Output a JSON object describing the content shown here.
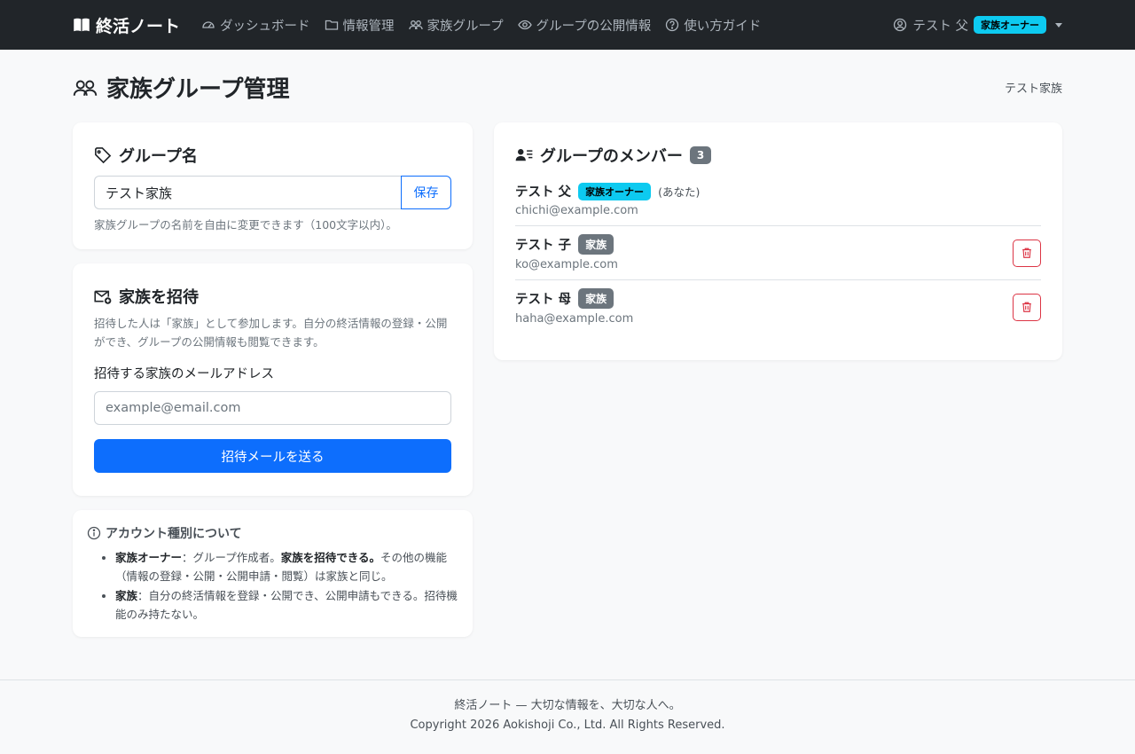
{
  "navbar": {
    "brand": "終活ノート",
    "items": [
      {
        "label": "ダッシュボード",
        "icon": "speedometer-icon"
      },
      {
        "label": "情報管理",
        "icon": "folder-icon"
      },
      {
        "label": "家族グループ",
        "icon": "people-icon"
      },
      {
        "label": "グループの公開情報",
        "icon": "eye-icon"
      },
      {
        "label": "使い方ガイド",
        "icon": "question-circle-icon"
      }
    ],
    "user_name": "テスト 父",
    "user_role": "家族オーナー"
  },
  "page": {
    "title": "家族グループ管理",
    "group_name": "テスト家族"
  },
  "group_card": {
    "title": "グループ名",
    "input_value": "テスト家族",
    "save_label": "保存",
    "help": "家族グループの名前を自由に変更できます（100文字以内）。"
  },
  "invite_card": {
    "title": "家族を招待",
    "description": "招待した人は「家族」として参加します。自分の終活情報の登録・公開ができ、グループの公開情報も閲覧できます。",
    "email_label": "招待する家族のメールアドレス",
    "email_placeholder": "example@email.com",
    "send_label": "招待メールを送る"
  },
  "info_card": {
    "title": "アカウント種別について",
    "items": [
      {
        "term": "家族オーナー",
        "text": "：グループ作成者。",
        "bold": "家族を招待できる。",
        "rest": "その他の機能（情報の登録・公開・公開申請・閲覧）は家族と同じ。"
      },
      {
        "term": "家族",
        "text": "：自分の終活情報を登録・公開でき、公開申請もできる。招待機能のみ持たない。"
      }
    ]
  },
  "members_card": {
    "title": "グループのメンバー",
    "count": "3",
    "members": [
      {
        "name": "テスト 父",
        "role": "家族オーナー",
        "you": "(あなた)",
        "email": "chichi@example.com"
      },
      {
        "name": "テスト 子",
        "role": "家族",
        "email": "ko@example.com"
      },
      {
        "name": "テスト 母",
        "role": "家族",
        "email": "haha@example.com"
      }
    ]
  },
  "footer": {
    "line1": "終活ノート — 大切な情報を、大切な人へ。",
    "line2": "Copyright 2026 Aokishoji Co., Ltd. All Rights Reserved."
  }
}
